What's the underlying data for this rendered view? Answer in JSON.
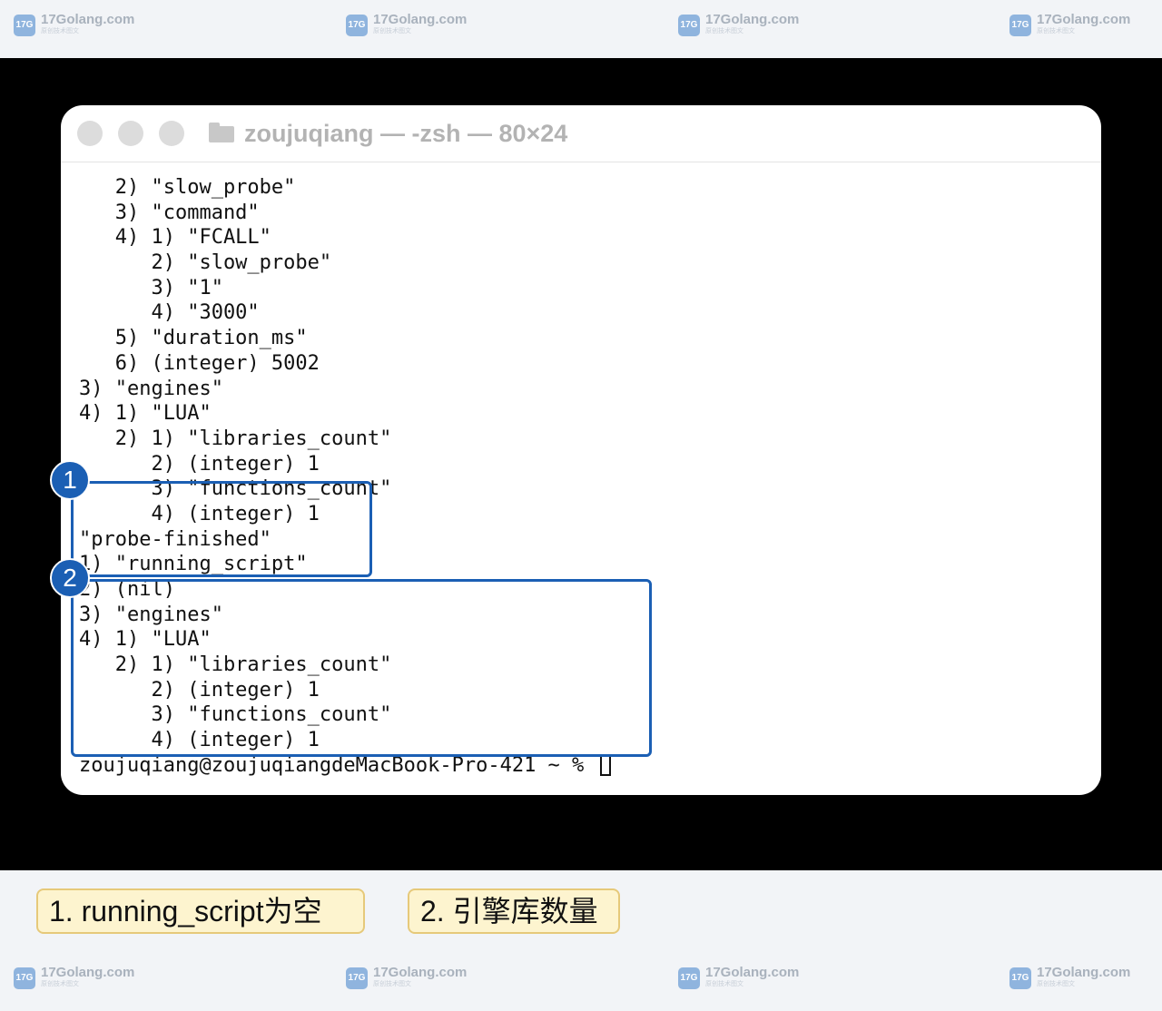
{
  "watermark": {
    "brand": "17Golang.com",
    "tagline": "原创技术图文",
    "logo_text": "17G"
  },
  "window": {
    "title": "zoujuqiang — -zsh — 80×24",
    "lines": [
      "   2) \"slow_probe\"",
      "   3) \"command\"",
      "   4) 1) \"FCALL\"",
      "      2) \"slow_probe\"",
      "      3) \"1\"",
      "      4) \"3000\"",
      "   5) \"duration_ms\"",
      "   6) (integer) 5002",
      "3) \"engines\"",
      "4) 1) \"LUA\"",
      "   2) 1) \"libraries_count\"",
      "      2) (integer) 1",
      "      3) \"functions_count\"",
      "      4) (integer) 1",
      "\"probe-finished\"",
      "1) \"running_script\"",
      "2) (nil)",
      "3) \"engines\"",
      "4) 1) \"LUA\"",
      "   2) 1) \"libraries_count\"",
      "      2) (integer) 1",
      "      3) \"functions_count\"",
      "      4) (integer) 1"
    ],
    "prompt": "zoujuqiang@zoujuqiangdeMacBook-Pro-421 ~ % "
  },
  "annotations": {
    "badge1": "1",
    "badge2": "2",
    "note1": "1. running_script为空",
    "note2": "2. 引擎库数量"
  },
  "colors": {
    "highlight": "#1b5fb4",
    "note_bg": "#fdf4cf",
    "note_border": "#e6c97a"
  }
}
